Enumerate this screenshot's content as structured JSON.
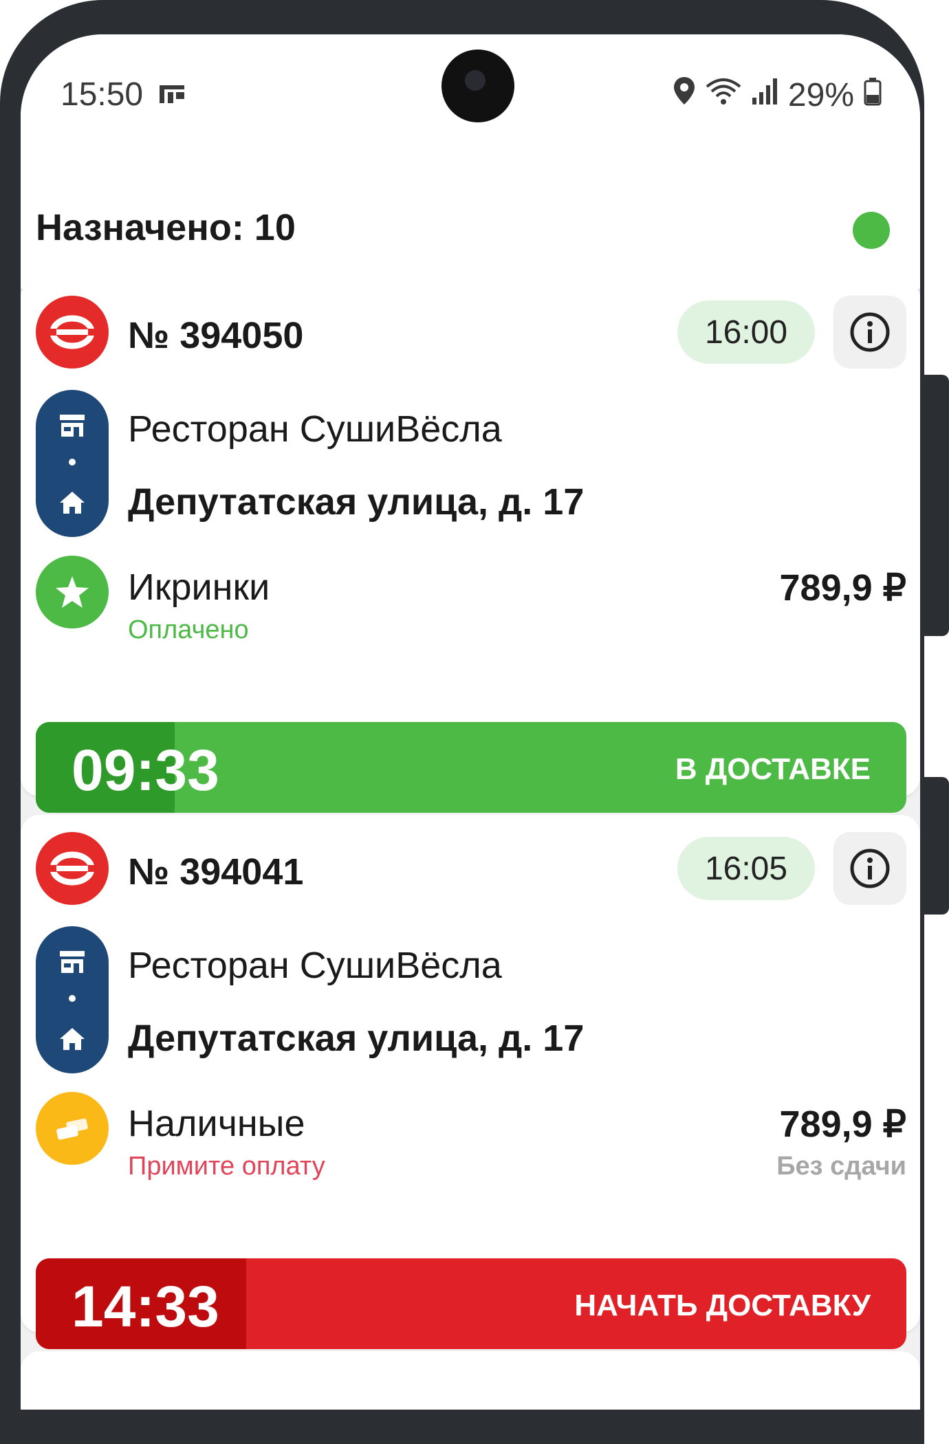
{
  "status_bar": {
    "time": "15:50",
    "battery": "29%"
  },
  "header": {
    "title": "Назначено: 10",
    "online_color": "#4cba45"
  },
  "orders": [
    {
      "number": "№ 394050",
      "time": "16:00",
      "restaurant": "Ресторан СушиВёсла",
      "address": "Депутатская улица, д. 17",
      "payment_method": "Икринки",
      "payment_status": "Оплачено",
      "payment_status_color": "#4cba45",
      "payment_icon": "star-icon",
      "amount": "789,9 ₽",
      "change_note": "",
      "timer": "09:33",
      "action_label": "В ДОСТАВКЕ",
      "action_color": "#4cba45"
    },
    {
      "number": "№ 394041",
      "time": "16:05",
      "restaurant": "Ресторан СушиВёсла",
      "address": "Депутатская улица, д. 17",
      "payment_method": "Наличные",
      "payment_status": "Примите оплату",
      "payment_status_color": "#e0455a",
      "payment_icon": "cash-icon",
      "amount": "789,9 ₽",
      "change_note": "Без сдачи",
      "timer": "14:33",
      "action_label": "НАЧАТЬ ДОСТАВКУ",
      "action_color": "#e02127"
    }
  ]
}
